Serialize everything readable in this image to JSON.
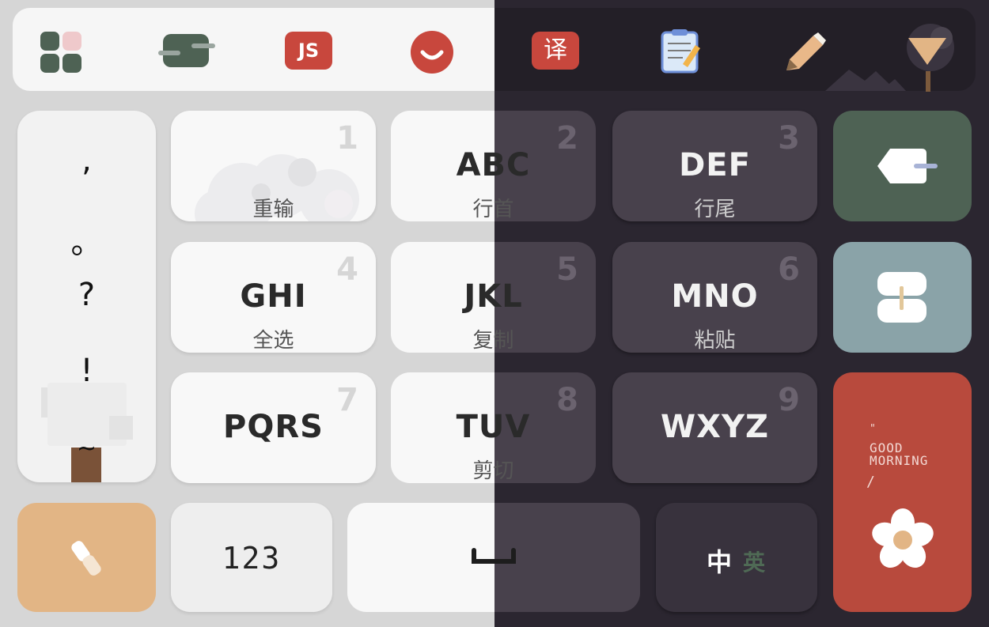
{
  "toolbar": {
    "icons": [
      "apps-icon",
      "switch-icon",
      "js-icon",
      "smile-icon",
      "translate-icon",
      "notepad-icon",
      "pencil-icon",
      "collapse-icon"
    ],
    "js_label": "JS",
    "translate_label": "译"
  },
  "punctuation": [
    ",",
    "。",
    "?",
    "!",
    "~"
  ],
  "keys": [
    {
      "num": "1",
      "main": "",
      "sub": "重输"
    },
    {
      "num": "2",
      "main": "ABC",
      "sub": "行首"
    },
    {
      "num": "3",
      "main": "DEF",
      "sub": "行尾"
    },
    {
      "num": "4",
      "main": "GHI",
      "sub": "全选"
    },
    {
      "num": "5",
      "main": "JKL",
      "sub": "复制"
    },
    {
      "num": "6",
      "main": "MNO",
      "sub": "粘贴"
    },
    {
      "num": "7",
      "main": "PQRS",
      "sub": ""
    },
    {
      "num": "8",
      "main": "TUV",
      "sub": "剪切"
    },
    {
      "num": "9",
      "main": "WXYZ",
      "sub": ""
    }
  ],
  "bottom": {
    "num_label": "123",
    "lang_zh": "中",
    "lang_en": "英"
  },
  "enter": {
    "quote": "\"",
    "line1": "GOOD",
    "line2": "MORNING",
    "slash": "/"
  },
  "colors": {
    "green": "#4e6254",
    "bluegray": "#8aa3a8",
    "red": "#b84a3d",
    "orange": "#e2b585"
  }
}
